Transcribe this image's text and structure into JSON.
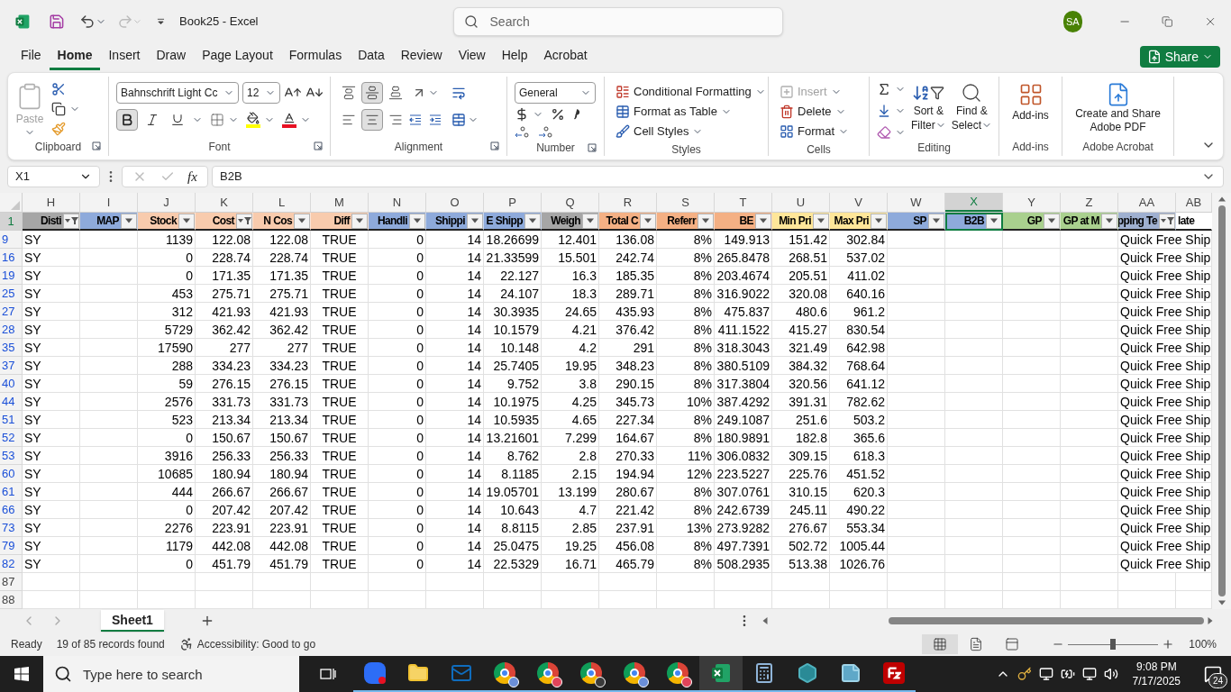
{
  "title_bar": {
    "title": "Book25 - Excel",
    "search_placeholder": "Search",
    "avatar": "SA"
  },
  "menu_tabs": [
    {
      "label": "File",
      "selected": false
    },
    {
      "label": "Home",
      "selected": true
    },
    {
      "label": "Insert",
      "selected": false
    },
    {
      "label": "Draw",
      "selected": false
    },
    {
      "label": "Page Layout",
      "selected": false
    },
    {
      "label": "Formulas",
      "selected": false
    },
    {
      "label": "Data",
      "selected": false
    },
    {
      "label": "Review",
      "selected": false
    },
    {
      "label": "View",
      "selected": false
    },
    {
      "label": "Help",
      "selected": false
    },
    {
      "label": "Acrobat",
      "selected": false
    }
  ],
  "share": "Share",
  "ribbon": {
    "groups": [
      {
        "kind": "clipboard",
        "label": "Clipboard",
        "launcher": true,
        "paste": "Paste"
      },
      {
        "kind": "font",
        "label": "Font",
        "launcher": true,
        "font_name": "Bahnschrift Light Cc",
        "font_size": "12",
        "bold": true,
        "italic": false,
        "underline": false
      },
      {
        "kind": "alignment",
        "label": "Alignment",
        "launcher": true,
        "vertical": [
          {
            "selected": false
          },
          {
            "selected": true
          },
          {
            "selected": false
          }
        ],
        "horizontal": [
          {
            "selected": false
          },
          {
            "selected": true
          },
          {
            "selected": false
          }
        ]
      },
      {
        "kind": "number",
        "label": "Number",
        "launcher": true,
        "format": "General"
      },
      {
        "kind": "styles",
        "label": "Styles",
        "launcher": false,
        "buttons": [
          "Conditional Formatting",
          "Format as Table",
          "Cell Styles"
        ]
      },
      {
        "kind": "cells",
        "label": "Cells",
        "launcher": false,
        "buttons": [
          {
            "label": "Insert",
            "disabled": true
          },
          {
            "label": "Delete",
            "disabled": false
          },
          {
            "label": "Format",
            "disabled": false
          }
        ]
      },
      {
        "kind": "editing",
        "label": "Editing",
        "launcher": false,
        "sort": [
          "Sort &",
          "Filter"
        ],
        "find": [
          "Find &",
          "Select"
        ]
      },
      {
        "kind": "addins",
        "label": "Add-ins",
        "launcher": false,
        "button": "Add-ins"
      },
      {
        "kind": "acrobat",
        "label": "Adobe Acrobat",
        "launcher": false,
        "button": [
          "Create and Share",
          "Adobe PDF"
        ]
      }
    ]
  },
  "formula_bar": {
    "name_box": "X1",
    "fx": "fx",
    "formula": "B2B"
  },
  "grid": {
    "columns": [
      {
        "letter": "H",
        "header": "Disti",
        "color": "#a6a6a6",
        "filter": true,
        "filter_applied": true,
        "left_aligned": true,
        "centered": false,
        "selected": false
      },
      {
        "letter": "I",
        "header": "MAP",
        "color": "#8eaadb",
        "filter": true,
        "filter_applied": false,
        "selected": false
      },
      {
        "letter": "J",
        "header": "Stock",
        "color": "#f8cbad",
        "filter": true,
        "filter_applied": false,
        "left_aligned": false,
        "centered": false,
        "selected": false
      },
      {
        "letter": "K",
        "header": "Cost",
        "color": "#f8cbad",
        "filter": true,
        "filter_applied": true,
        "left_aligned": false,
        "centered": false,
        "selected": false
      },
      {
        "letter": "L",
        "header": "N Cos",
        "color": "#f8cbad",
        "filter": true,
        "filter_applied": false,
        "left_aligned": false,
        "centered": false,
        "selected": false
      },
      {
        "letter": "M",
        "header": "Diff",
        "color": "#f8cbad",
        "filter": true,
        "filter_applied": false,
        "left_aligned": false,
        "centered": true,
        "selected": false
      },
      {
        "letter": "N",
        "header": "Handli",
        "color": "#8eaadb",
        "filter": true,
        "filter_applied": false,
        "left_aligned": false,
        "centered": false,
        "selected": false
      },
      {
        "letter": "O",
        "header": "Shippi",
        "color": "#8eaadb",
        "filter": true,
        "filter_applied": false,
        "left_aligned": false,
        "centered": false,
        "selected": false
      },
      {
        "letter": "P",
        "header": "E Shipp",
        "color": "#8eaadb",
        "filter": true,
        "filter_applied": false,
        "left_aligned": false,
        "centered": false,
        "selected": false
      },
      {
        "letter": "Q",
        "header": "Weigh",
        "color": "#a6a6a6",
        "filter": true,
        "filter_applied": false,
        "left_aligned": false,
        "centered": false,
        "selected": false
      },
      {
        "letter": "R",
        "header": "Total C",
        "color": "#f4b084",
        "filter": true,
        "filter_applied": false,
        "left_aligned": false,
        "centered": false,
        "selected": false
      },
      {
        "letter": "S",
        "header": "Referr",
        "color": "#f4b084",
        "filter": true,
        "filter_applied": false,
        "left_aligned": false,
        "centered": false,
        "selected": false
      },
      {
        "letter": "T",
        "header": "BE",
        "color": "#f4b084",
        "filter": true,
        "filter_applied": false,
        "left_aligned": false,
        "centered": false,
        "selected": false
      },
      {
        "letter": "U",
        "header": "Min Pri",
        "color": "#ffe699",
        "filter": true,
        "filter_applied": false,
        "left_aligned": false,
        "centered": false,
        "selected": false
      },
      {
        "letter": "V",
        "header": "Max Pri",
        "color": "#ffe699",
        "filter": true,
        "filter_applied": false,
        "left_aligned": false,
        "centered": false,
        "selected": false
      },
      {
        "letter": "W",
        "header": "SP",
        "color": "#8eaadb",
        "filter": true,
        "filter_applied": false,
        "selected": false
      },
      {
        "letter": "X",
        "header": "B2B",
        "color": "#8eaadb",
        "filter": true,
        "filter_applied": false,
        "selected": true
      },
      {
        "letter": "Y",
        "header": "GP",
        "color": "#a9d08e",
        "filter": true,
        "filter_applied": false,
        "selected": false
      },
      {
        "letter": "Z",
        "header": "GP at M",
        "color": "#a9d08e",
        "filter": true,
        "filter_applied": false,
        "selected": false
      },
      {
        "letter": "AA",
        "header": "pping Te",
        "color": "#9fb0d0",
        "filter": true,
        "filter_applied": true,
        "left_aligned": true,
        "centered": false,
        "selected": false
      },
      {
        "letter": "AB",
        "header": "late",
        "color": "#ffffff",
        "filter": false,
        "selected": false
      }
    ],
    "header_row": {
      "row": "1",
      "selected": true
    },
    "rows": [
      {
        "row": "9",
        "filtered": true,
        "H": "SY",
        "J": "1139",
        "K": "122.08",
        "L": "122.08",
        "M": "TRUE",
        "N": "0",
        "O": "14",
        "P": "18.26699",
        "Q": "12.401",
        "R": "136.08",
        "S": "8%",
        "T": "149.913",
        "U": "151.42",
        "V": "302.84",
        "AA": "Quick Free Ship"
      },
      {
        "row": "16",
        "filtered": true,
        "H": "SY",
        "J": "0",
        "K": "228.74",
        "L": "228.74",
        "M": "TRUE",
        "N": "0",
        "O": "14",
        "P": "21.33599",
        "Q": "15.501",
        "R": "242.74",
        "S": "8%",
        "T": "265.8478",
        "U": "268.51",
        "V": "537.02",
        "AA": "Quick Free Ship"
      },
      {
        "row": "19",
        "filtered": true,
        "H": "SY",
        "J": "0",
        "K": "171.35",
        "L": "171.35",
        "M": "TRUE",
        "N": "0",
        "O": "14",
        "P": "22.127",
        "Q": "16.3",
        "R": "185.35",
        "S": "8%",
        "T": "203.4674",
        "U": "205.51",
        "V": "411.02",
        "AA": "Quick Free Ship"
      },
      {
        "row": "25",
        "filtered": true,
        "H": "SY",
        "J": "453",
        "K": "275.71",
        "L": "275.71",
        "M": "TRUE",
        "N": "0",
        "O": "14",
        "P": "24.107",
        "Q": "18.3",
        "R": "289.71",
        "S": "8%",
        "T": "316.9022",
        "U": "320.08",
        "V": "640.16",
        "AA": "Quick Free Ship"
      },
      {
        "row": "27",
        "filtered": true,
        "H": "SY",
        "J": "312",
        "K": "421.93",
        "L": "421.93",
        "M": "TRUE",
        "N": "0",
        "O": "14",
        "P": "30.3935",
        "Q": "24.65",
        "R": "435.93",
        "S": "8%",
        "T": "475.837",
        "U": "480.6",
        "V": "961.2",
        "AA": "Quick Free Ship"
      },
      {
        "row": "28",
        "filtered": true,
        "H": "SY",
        "J": "5729",
        "K": "362.42",
        "L": "362.42",
        "M": "TRUE",
        "N": "0",
        "O": "14",
        "P": "10.1579",
        "Q": "4.21",
        "R": "376.42",
        "S": "8%",
        "T": "411.1522",
        "U": "415.27",
        "V": "830.54",
        "AA": "Quick Free Ship"
      },
      {
        "row": "35",
        "filtered": true,
        "H": "SY",
        "J": "17590",
        "K": "277",
        "L": "277",
        "M": "TRUE",
        "N": "0",
        "O": "14",
        "P": "10.148",
        "Q": "4.2",
        "R": "291",
        "S": "8%",
        "T": "318.3043",
        "U": "321.49",
        "V": "642.98",
        "AA": "Quick Free Ship"
      },
      {
        "row": "37",
        "filtered": true,
        "H": "SY",
        "J": "288",
        "K": "334.23",
        "L": "334.23",
        "M": "TRUE",
        "N": "0",
        "O": "14",
        "P": "25.7405",
        "Q": "19.95",
        "R": "348.23",
        "S": "8%",
        "T": "380.5109",
        "U": "384.32",
        "V": "768.64",
        "AA": "Quick Free Ship"
      },
      {
        "row": "40",
        "filtered": true,
        "H": "SY",
        "J": "59",
        "K": "276.15",
        "L": "276.15",
        "M": "TRUE",
        "N": "0",
        "O": "14",
        "P": "9.752",
        "Q": "3.8",
        "R": "290.15",
        "S": "8%",
        "T": "317.3804",
        "U": "320.56",
        "V": "641.12",
        "AA": "Quick Free Ship"
      },
      {
        "row": "44",
        "filtered": true,
        "H": "SY",
        "J": "2576",
        "K": "331.73",
        "L": "331.73",
        "M": "TRUE",
        "N": "0",
        "O": "14",
        "P": "10.1975",
        "Q": "4.25",
        "R": "345.73",
        "S": "10%",
        "T": "387.4292",
        "U": "391.31",
        "V": "782.62",
        "AA": "Quick Free Ship"
      },
      {
        "row": "51",
        "filtered": true,
        "H": "SY",
        "J": "523",
        "K": "213.34",
        "L": "213.34",
        "M": "TRUE",
        "N": "0",
        "O": "14",
        "P": "10.5935",
        "Q": "4.65",
        "R": "227.34",
        "S": "8%",
        "T": "249.1087",
        "U": "251.6",
        "V": "503.2",
        "AA": "Quick Free Ship"
      },
      {
        "row": "52",
        "filtered": true,
        "H": "SY",
        "J": "0",
        "K": "150.67",
        "L": "150.67",
        "M": "TRUE",
        "N": "0",
        "O": "14",
        "P": "13.21601",
        "Q": "7.299",
        "R": "164.67",
        "S": "8%",
        "T": "180.9891",
        "U": "182.8",
        "V": "365.6",
        "AA": "Quick Free Ship"
      },
      {
        "row": "53",
        "filtered": true,
        "H": "SY",
        "J": "3916",
        "K": "256.33",
        "L": "256.33",
        "M": "TRUE",
        "N": "0",
        "O": "14",
        "P": "8.762",
        "Q": "2.8",
        "R": "270.33",
        "S": "11%",
        "T": "306.0832",
        "U": "309.15",
        "V": "618.3",
        "AA": "Quick Free Ship"
      },
      {
        "row": "60",
        "filtered": true,
        "H": "SY",
        "J": "10685",
        "K": "180.94",
        "L": "180.94",
        "M": "TRUE",
        "N": "0",
        "O": "14",
        "P": "8.1185",
        "Q": "2.15",
        "R": "194.94",
        "S": "12%",
        "T": "223.5227",
        "U": "225.76",
        "V": "451.52",
        "AA": "Quick Free Ship"
      },
      {
        "row": "61",
        "filtered": true,
        "H": "SY",
        "J": "444",
        "K": "266.67",
        "L": "266.67",
        "M": "TRUE",
        "N": "0",
        "O": "14",
        "P": "19.05701",
        "Q": "13.199",
        "R": "280.67",
        "S": "8%",
        "T": "307.0761",
        "U": "310.15",
        "V": "620.3",
        "AA": "Quick Free Ship"
      },
      {
        "row": "66",
        "filtered": true,
        "H": "SY",
        "J": "0",
        "K": "207.42",
        "L": "207.42",
        "M": "TRUE",
        "N": "0",
        "O": "14",
        "P": "10.643",
        "Q": "4.7",
        "R": "221.42",
        "S": "8%",
        "T": "242.6739",
        "U": "245.11",
        "V": "490.22",
        "AA": "Quick Free Ship"
      },
      {
        "row": "73",
        "filtered": true,
        "H": "SY",
        "J": "2276",
        "K": "223.91",
        "L": "223.91",
        "M": "TRUE",
        "N": "0",
        "O": "14",
        "P": "8.8115",
        "Q": "2.85",
        "R": "237.91",
        "S": "13%",
        "T": "273.9282",
        "U": "276.67",
        "V": "553.34",
        "AA": "Quick Free Ship"
      },
      {
        "row": "79",
        "filtered": true,
        "H": "SY",
        "J": "1179",
        "K": "442.08",
        "L": "442.08",
        "M": "TRUE",
        "N": "0",
        "O": "14",
        "P": "25.0475",
        "Q": "19.25",
        "R": "456.08",
        "S": "8%",
        "T": "497.7391",
        "U": "502.72",
        "V": "1005.44",
        "AA": "Quick Free Ship"
      },
      {
        "row": "82",
        "filtered": true,
        "H": "SY",
        "J": "0",
        "K": "451.79",
        "L": "451.79",
        "M": "TRUE",
        "N": "0",
        "O": "14",
        "P": "22.5329",
        "Q": "16.71",
        "R": "465.79",
        "S": "8%",
        "T": "508.2935",
        "U": "513.38",
        "V": "1026.76",
        "AA": "Quick Free Ship"
      },
      {
        "row": "87",
        "filtered": false
      },
      {
        "row": "88",
        "filtered": false
      }
    ]
  },
  "sheet_tabs": [
    {
      "label": "Sheet1",
      "selected": true
    }
  ],
  "status_bar": {
    "ready": "Ready",
    "records": "19 of 85 records found",
    "accessibility": "Accessibility: Good to go",
    "views": [
      {
        "selected": true
      },
      {
        "selected": false
      },
      {
        "selected": false
      }
    ],
    "zoom": {
      "level": 0.5
    },
    "zoom_text": "100%"
  },
  "taskbar": {
    "search_placeholder": "Type here to search",
    "apps": [
      {
        "kind": "zoom",
        "selected": false
      },
      {
        "kind": "explorer",
        "selected": false
      },
      {
        "kind": "outlook",
        "selected": false
      },
      {
        "kind": "chrome",
        "selected": false,
        "color": "#6b8fd8"
      },
      {
        "kind": "chrome",
        "selected": false,
        "color": "#e0445a"
      },
      {
        "kind": "chrome",
        "selected": false,
        "color": "#3a3a3a"
      },
      {
        "kind": "chrome",
        "selected": false,
        "color": "#6b8fd8"
      },
      {
        "kind": "chrome",
        "selected": false,
        "color": "#e0445a"
      },
      {
        "kind": "excel",
        "selected": true
      },
      {
        "kind": "calculator",
        "selected": false
      },
      {
        "kind": "hexagon",
        "selected": false
      },
      {
        "kind": "notes",
        "selected": false
      },
      {
        "kind": "filezilla",
        "selected": false
      }
    ],
    "time": "9:08 PM",
    "date": "7/17/2025",
    "notifications": "24"
  }
}
